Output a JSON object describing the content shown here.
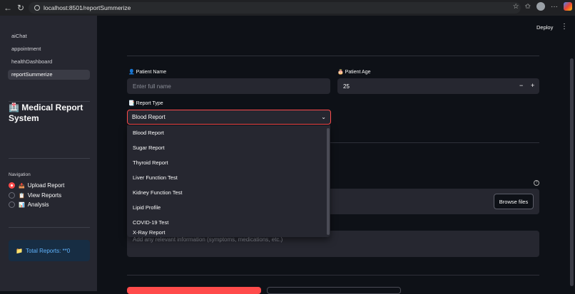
{
  "browser": {
    "url": "localhost:8501/reportSummerize"
  },
  "sidebar": {
    "pages": [
      {
        "label": "aiChat"
      },
      {
        "label": "appointment"
      },
      {
        "label": "healthDashboard"
      },
      {
        "label": "reportSummerize"
      }
    ],
    "title": "Medical Report System",
    "title_icon": "🏥",
    "navigation_label": "Navigation",
    "nav_options": [
      {
        "label": "Upload Report",
        "icon": "📤",
        "selected": true
      },
      {
        "label": "View Reports",
        "icon": "📋",
        "selected": false
      },
      {
        "label": "Analysis",
        "icon": "📊",
        "selected": false
      }
    ],
    "total_reports": "Total Reports: **0"
  },
  "header": {
    "deploy_label": "Deploy",
    "menu_icon": "⋮"
  },
  "form": {
    "patient_name_label": "Patient Name",
    "patient_name_placeholder": "Enter full name",
    "patient_age_label": "Patient Age",
    "patient_age_value": "25",
    "report_type_label": "Report Type",
    "report_type_selected": "Blood Report",
    "report_type_options": [
      "Blood Report",
      "Sugar Report",
      "Thyroid Report",
      "Liver Function Test",
      "Kidney Function Test",
      "Lipid Profile",
      "COVID-19 Test",
      "X-Ray Report"
    ],
    "browse_label": "Browse files",
    "notes_placeholder": "Add any relevant information (symptoms, medications, etc.)"
  },
  "colors": {
    "accent": "#ff4b4b",
    "sidebar_bg": "#262730",
    "main_bg": "#0e1117",
    "info_blue": "#60b4ff"
  }
}
